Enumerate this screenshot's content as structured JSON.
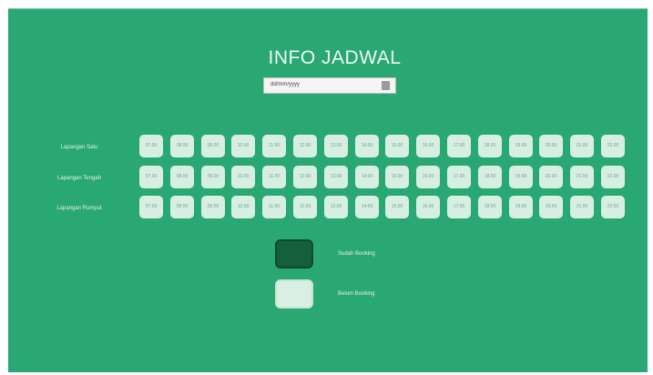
{
  "header": {
    "title": "INFO JADWAL"
  },
  "date_picker": {
    "value": "dd/mm/yyyy",
    "icon": "calendar-icon"
  },
  "schedule": {
    "rows": [
      {
        "label": "Lapangan Satu",
        "slots": [
          "07.00",
          "08.00",
          "09.00",
          "10.00",
          "11.00",
          "12.00",
          "13.00",
          "14.00",
          "15.00",
          "16.00",
          "17.00",
          "18.00",
          "19.00",
          "20.00",
          "21.00",
          "22.00"
        ]
      },
      {
        "label": "Lapangan Tengah",
        "slots": [
          "07.00",
          "08.00",
          "09.00",
          "10.00",
          "11.00",
          "12.00",
          "13.00",
          "14.00",
          "15.00",
          "16.00",
          "17.00",
          "18.00",
          "19.00",
          "20.00",
          "21.00",
          "22.00"
        ]
      },
      {
        "label": "Lapangan Rumput",
        "slots": [
          "07.00",
          "08.00",
          "09.00",
          "10.00",
          "11.00",
          "12.00",
          "13.00",
          "14.00",
          "15.00",
          "16.00",
          "17.00",
          "18.00",
          "19.00",
          "20.00",
          "21.00",
          "22.00"
        ]
      }
    ]
  },
  "legend": {
    "booked": {
      "label": "Sudah Booking",
      "color": "#165f3d"
    },
    "available": {
      "label": "Belum Booking",
      "color": "#d9efe4"
    }
  },
  "colors": {
    "panel_background": "#2aa874",
    "slot_available": "#d7efe3"
  }
}
